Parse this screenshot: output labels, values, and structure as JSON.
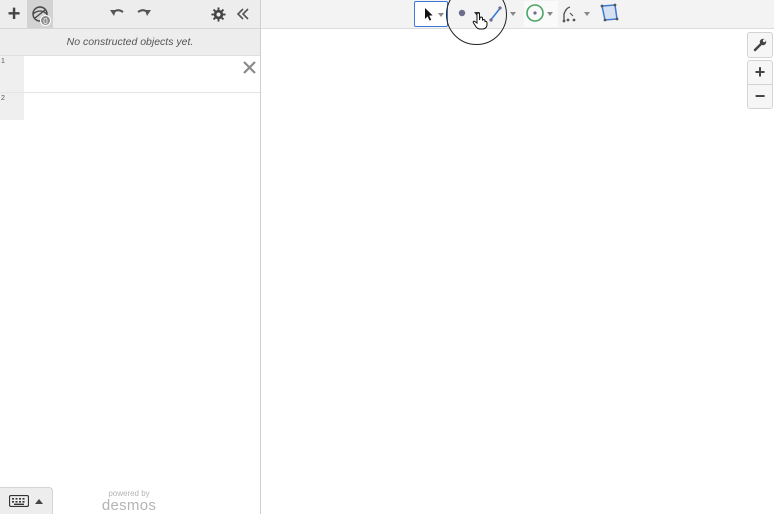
{
  "left_panel": {
    "toolbar": {
      "add_label": "+",
      "tools_badge": "0"
    },
    "empty_message": "No constructed objects yet.",
    "expressions": [
      {
        "number": "1"
      },
      {
        "number": "2"
      }
    ],
    "powered_by": "powered by",
    "brand": "desmos"
  },
  "canvas_toolbar": {
    "tools": [
      "select-tool",
      "point-tool",
      "line-tool",
      "circle-tool",
      "transform-tool",
      "polygon-tool"
    ]
  },
  "side_controls": {
    "zoom_in": "+",
    "zoom_out": "−"
  },
  "colors": {
    "accent_blue": "#3c79d6",
    "circle_green": "#4aa564",
    "polygon_blue": "#3c79d6"
  }
}
